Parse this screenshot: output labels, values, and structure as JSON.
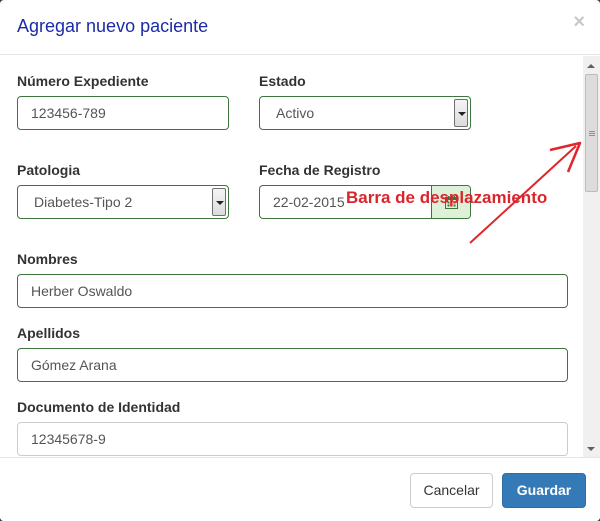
{
  "modal": {
    "title": "Agregar nuevo paciente",
    "close_symbol": "×"
  },
  "form": {
    "expediente": {
      "label": "Número Expediente",
      "value": "123456-789"
    },
    "estado": {
      "label": "Estado",
      "value": "Activo"
    },
    "patologia": {
      "label": "Patologia",
      "value": "Diabetes-Tipo 2"
    },
    "fecha_registro": {
      "label": "Fecha de Registro",
      "value": "22-02-2015",
      "icon": "calendar-icon"
    },
    "nombres": {
      "label": "Nombres",
      "value": "Herber Oswaldo"
    },
    "apellidos": {
      "label": "Apellidos",
      "value": "Gómez Arana"
    },
    "documento": {
      "label": "Documento de Identidad",
      "value": "12345678-9"
    }
  },
  "annotation": {
    "text": "Barra de desplazamiento",
    "color": "#d9262b"
  },
  "footer": {
    "cancel_label": "Cancelar",
    "save_label": "Guardar"
  },
  "colors": {
    "title": "#1c2ba8",
    "valid_border": "#3c763d",
    "valid_addon": "#dff0d8",
    "primary_button": "#337ab7"
  }
}
